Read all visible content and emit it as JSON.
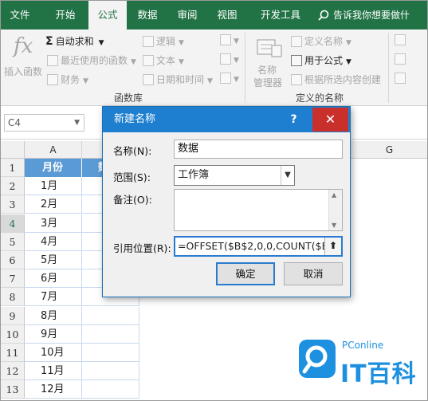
{
  "tabs": [
    "文件",
    "开始",
    "公式",
    "数据",
    "审阅",
    "视图",
    "开发工具"
  ],
  "active_tab": "公式",
  "tell_me": "告诉我你想要做什",
  "ribbon": {
    "insert_function": "插入函数",
    "fx_symbol": "fx",
    "autosum": "自动求和",
    "recent": "最近使用的函数",
    "finance": "财务",
    "logic": "逻辑",
    "text": "文本",
    "datetime": "日期和时间",
    "group_library": "函数库",
    "define_name": "定义名称",
    "use_in_formula": "用于公式",
    "create_from_selection": "根据所选内容创建",
    "name_manager_1": "名称",
    "name_manager_2": "管理器",
    "group_defined_names": "定义的名称"
  },
  "name_box": "C4",
  "columns": {
    "a": "A",
    "g": "G"
  },
  "rows": [
    "1",
    "2",
    "3",
    "4",
    "5",
    "6",
    "7",
    "8",
    "9",
    "10",
    "11",
    "12",
    "13"
  ],
  "table": {
    "header_a": "月份",
    "header_b": "数",
    "months": [
      "1月",
      "2月",
      "3月",
      "4月",
      "5月",
      "6月",
      "7月",
      "8月",
      "9月",
      "10月",
      "11月",
      "12月"
    ]
  },
  "dialog": {
    "title": "新建名称",
    "help": "?",
    "close": "✕",
    "name_label": "名称(N):",
    "name_value": "数据",
    "scope_label": "范围(S):",
    "scope_value": "工作簿",
    "comment_label": "备注(O):",
    "ref_label": "引用位置(R):",
    "ref_value": "=OFFSET($B$2,0,0,COUNT($B:$",
    "ok": "确定",
    "cancel": "取消"
  },
  "watermark": {
    "sub": "PConline",
    "main": "IT百科"
  },
  "colors": {
    "excel_green": "#217346",
    "table_header_blue": "#5b9bd5",
    "dialog_blue": "#1e7fd0",
    "close_red": "#c9302c"
  }
}
